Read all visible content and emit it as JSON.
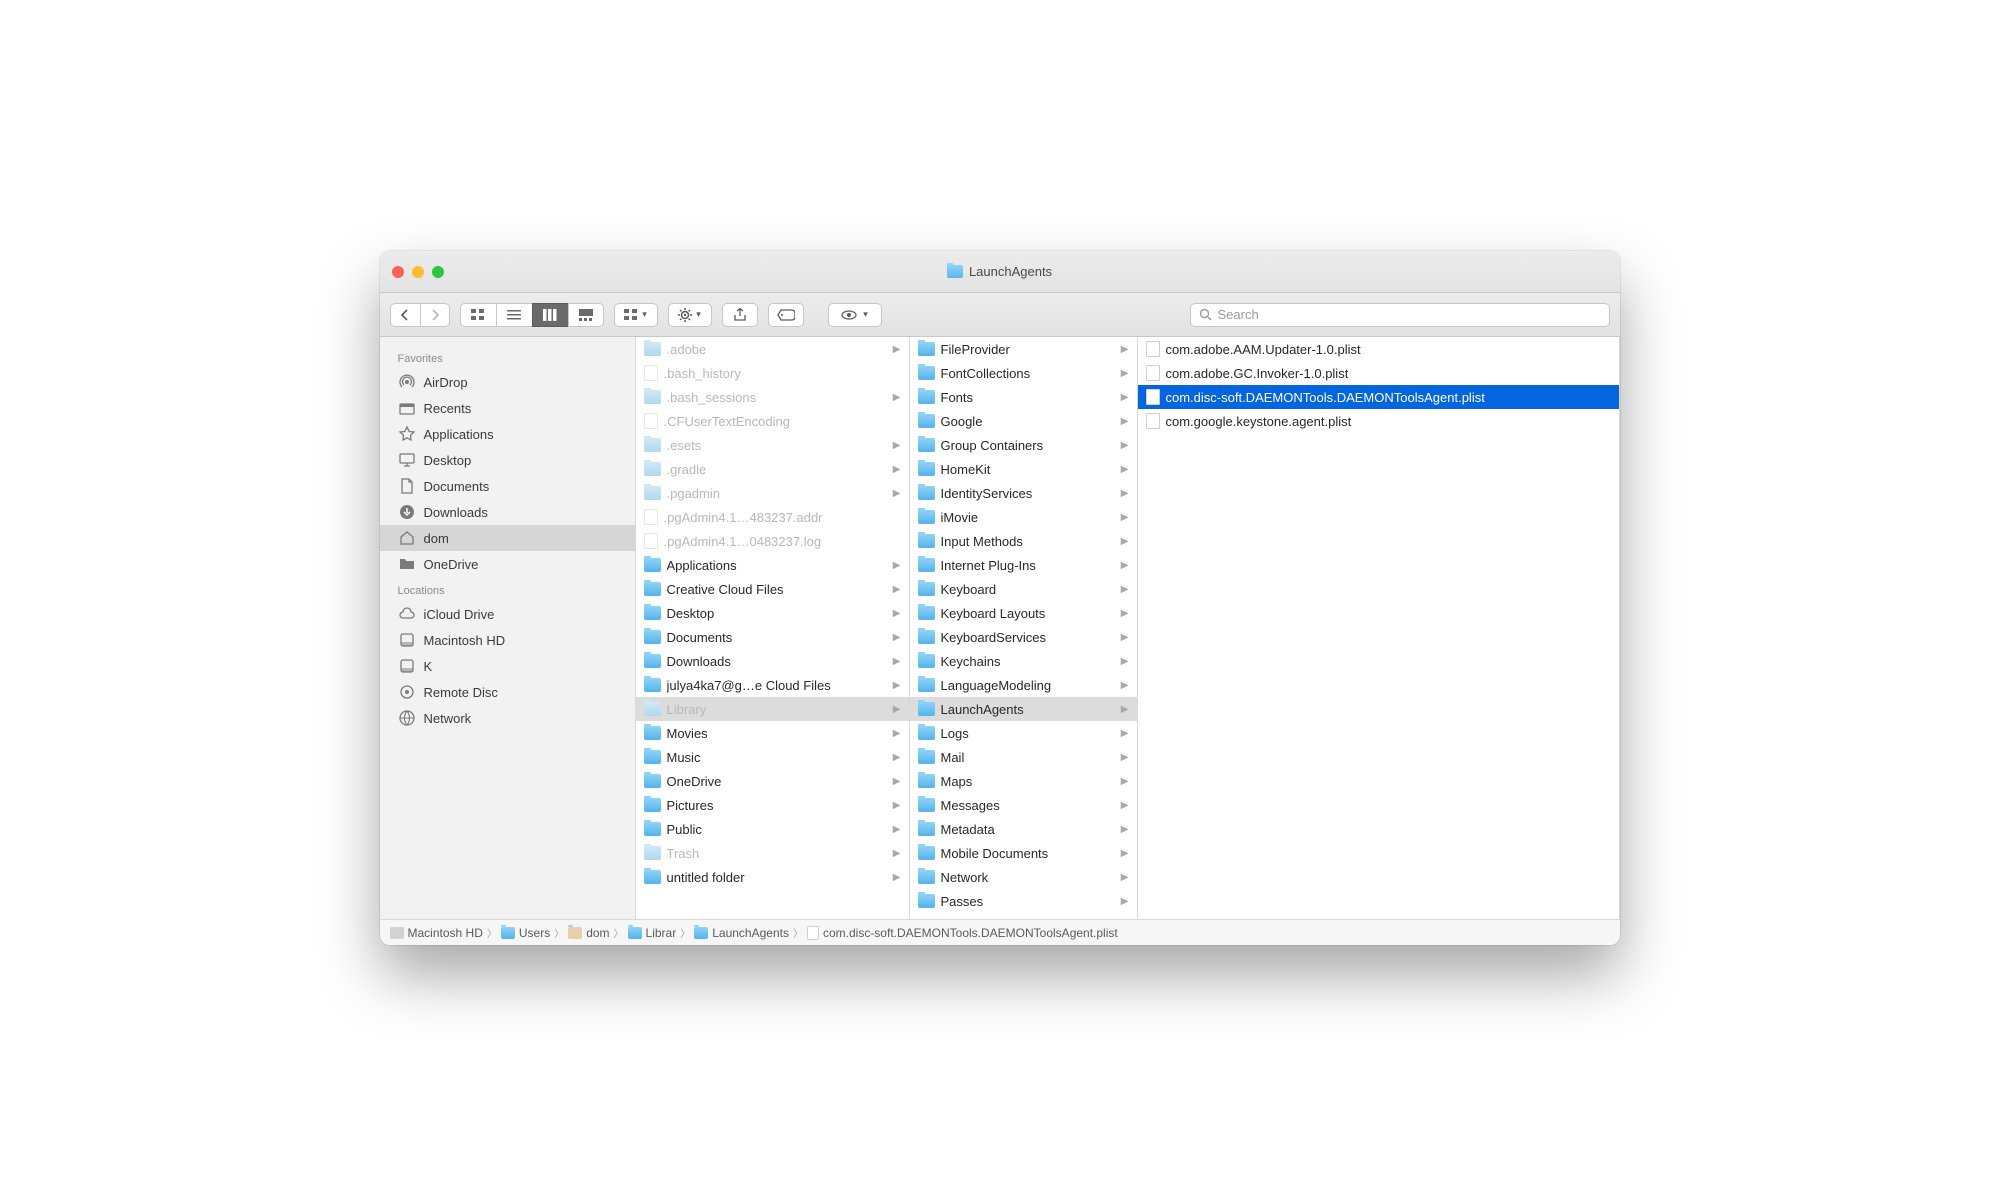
{
  "window": {
    "title": "LaunchAgents"
  },
  "search": {
    "placeholder": "Search"
  },
  "sidebar": {
    "sections": [
      {
        "heading": "Favorites",
        "items": [
          {
            "icon": "airdrop",
            "label": "AirDrop"
          },
          {
            "icon": "recents",
            "label": "Recents"
          },
          {
            "icon": "apps",
            "label": "Applications"
          },
          {
            "icon": "desktop",
            "label": "Desktop"
          },
          {
            "icon": "documents",
            "label": "Documents"
          },
          {
            "icon": "downloads",
            "label": "Downloads"
          },
          {
            "icon": "home",
            "label": "dom",
            "selected": true
          },
          {
            "icon": "folder",
            "label": "OneDrive"
          }
        ]
      },
      {
        "heading": "Locations",
        "items": [
          {
            "icon": "icloud",
            "label": "iCloud Drive"
          },
          {
            "icon": "disk",
            "label": "Macintosh HD"
          },
          {
            "icon": "disk",
            "label": "K"
          },
          {
            "icon": "remote",
            "label": "Remote Disc"
          },
          {
            "icon": "network",
            "label": "Network"
          }
        ]
      }
    ]
  },
  "columns": [
    [
      {
        "icon": "folder-dim",
        "label": ".adobe",
        "arrow": true,
        "hidden": true
      },
      {
        "icon": "file-dim",
        "label": ".bash_history",
        "hidden": true
      },
      {
        "icon": "folder-dim",
        "label": ".bash_sessions",
        "arrow": true,
        "hidden": true
      },
      {
        "icon": "file-dim",
        "label": ".CFUserTextEncoding",
        "hidden": true
      },
      {
        "icon": "folder-dim",
        "label": ".esets",
        "arrow": true,
        "hidden": true
      },
      {
        "icon": "folder-dim",
        "label": ".gradle",
        "arrow": true,
        "hidden": true
      },
      {
        "icon": "folder-dim",
        "label": ".pgadmin",
        "arrow": true,
        "hidden": true
      },
      {
        "icon": "file-dim",
        "label": ".pgAdmin4.1…483237.addr",
        "hidden": true
      },
      {
        "icon": "file-dim",
        "label": ".pgAdmin4.1…0483237.log",
        "hidden": true
      },
      {
        "icon": "folder",
        "label": "Applications",
        "arrow": true
      },
      {
        "icon": "folder",
        "label": "Creative Cloud Files",
        "arrow": true
      },
      {
        "icon": "folder",
        "label": "Desktop",
        "arrow": true
      },
      {
        "icon": "folder",
        "label": "Documents",
        "arrow": true
      },
      {
        "icon": "folder",
        "label": "Downloads",
        "arrow": true
      },
      {
        "icon": "folder",
        "label": "julya4ka7@g…e Cloud Files",
        "arrow": true
      },
      {
        "icon": "folder-dim",
        "label": "Library",
        "arrow": true,
        "hidden": true,
        "pathsel": true
      },
      {
        "icon": "folder",
        "label": "Movies",
        "arrow": true
      },
      {
        "icon": "folder",
        "label": "Music",
        "arrow": true
      },
      {
        "icon": "folder",
        "label": "OneDrive",
        "arrow": true
      },
      {
        "icon": "folder",
        "label": "Pictures",
        "arrow": true
      },
      {
        "icon": "folder",
        "label": "Public",
        "arrow": true
      },
      {
        "icon": "folder-dim",
        "label": "Trash",
        "arrow": true,
        "hidden": true
      },
      {
        "icon": "folder",
        "label": "untitled folder",
        "arrow": true
      }
    ],
    [
      {
        "icon": "folder",
        "label": "FileProvider",
        "arrow": true
      },
      {
        "icon": "folder",
        "label": "FontCollections",
        "arrow": true
      },
      {
        "icon": "folder",
        "label": "Fonts",
        "arrow": true
      },
      {
        "icon": "folder",
        "label": "Google",
        "arrow": true
      },
      {
        "icon": "folder",
        "label": "Group Containers",
        "arrow": true
      },
      {
        "icon": "folder",
        "label": "HomeKit",
        "arrow": true
      },
      {
        "icon": "folder",
        "label": "IdentityServices",
        "arrow": true
      },
      {
        "icon": "folder",
        "label": "iMovie",
        "arrow": true
      },
      {
        "icon": "folder",
        "label": "Input Methods",
        "arrow": true
      },
      {
        "icon": "folder",
        "label": "Internet Plug-Ins",
        "arrow": true
      },
      {
        "icon": "folder",
        "label": "Keyboard",
        "arrow": true
      },
      {
        "icon": "folder",
        "label": "Keyboard Layouts",
        "arrow": true
      },
      {
        "icon": "folder",
        "label": "KeyboardServices",
        "arrow": true
      },
      {
        "icon": "folder",
        "label": "Keychains",
        "arrow": true
      },
      {
        "icon": "folder",
        "label": "LanguageModeling",
        "arrow": true
      },
      {
        "icon": "folder",
        "label": "LaunchAgents",
        "arrow": true,
        "pathsel": true
      },
      {
        "icon": "folder",
        "label": "Logs",
        "arrow": true
      },
      {
        "icon": "folder",
        "label": "Mail",
        "arrow": true
      },
      {
        "icon": "folder",
        "label": "Maps",
        "arrow": true
      },
      {
        "icon": "folder",
        "label": "Messages",
        "arrow": true
      },
      {
        "icon": "folder",
        "label": "Metadata",
        "arrow": true
      },
      {
        "icon": "folder",
        "label": "Mobile Documents",
        "arrow": true
      },
      {
        "icon": "folder",
        "label": "Network",
        "arrow": true
      },
      {
        "icon": "folder",
        "label": "Passes",
        "arrow": true
      }
    ],
    [
      {
        "icon": "file",
        "label": "com.adobe.AAM.Updater-1.0.plist"
      },
      {
        "icon": "file",
        "label": "com.adobe.GC.Invoker-1.0.plist"
      },
      {
        "icon": "file",
        "label": "com.disc-soft.DAEMONTools.DAEMONToolsAgent.plist",
        "selected": true
      },
      {
        "icon": "file",
        "label": "com.google.keystone.agent.plist"
      }
    ]
  ],
  "pathbar": [
    {
      "icon": "disk",
      "label": "Macintosh HD"
    },
    {
      "icon": "folder",
      "label": "Users"
    },
    {
      "icon": "home",
      "label": "dom"
    },
    {
      "icon": "folder",
      "label": "Librar"
    },
    {
      "icon": "folder",
      "label": "LaunchAgents"
    },
    {
      "icon": "file",
      "label": "com.disc-soft.DAEMONTools.DAEMONToolsAgent.plist"
    }
  ]
}
